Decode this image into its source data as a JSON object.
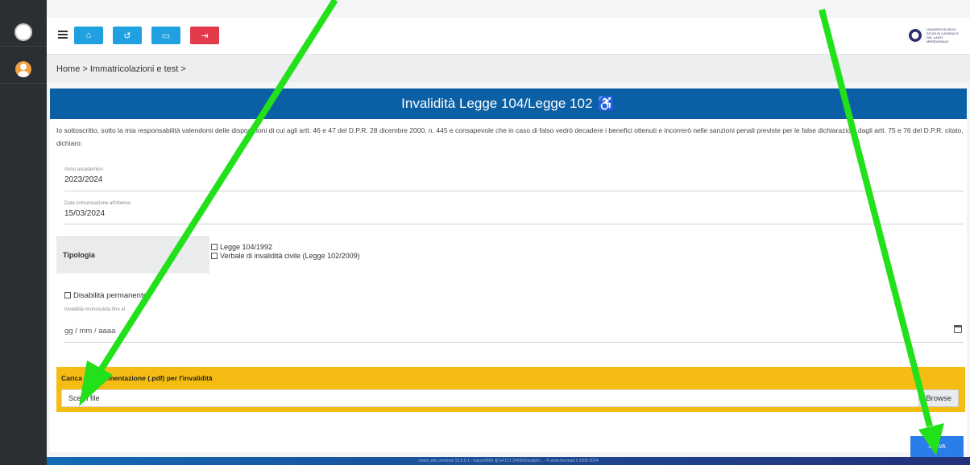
{
  "title_bar": {
    "title": "Invalidità Legge 104/Legge 102"
  },
  "breadcrumb": "Home > Immatricolazioni e test >",
  "intro": "Io sottoscritto, sotto la mia responsabilità valendomi delle disposizioni di cui agli artt. 46 e 47 del D.P.R. 28 dicembre 2000, n. 445 e consapevole che in caso di falso vedrò decadere i benefici ottenuti e incorrerò nelle sanzioni penali previste per le false dichiarazioni dagli artt. 75 e 76 del D.P.R. citato, dichiaro:",
  "fields": {
    "anno": {
      "label": "Anno accademico",
      "value": "2023/2024"
    },
    "data": {
      "label": "Data comunicazione all'Ateneo",
      "value": "15/03/2024"
    }
  },
  "tipologia": {
    "label": "Tipologia",
    "options": [
      "Legge 104/1992",
      "Verbale di invalidità civile (Legge 102/2009)"
    ]
  },
  "permanente": {
    "label": "Disabilità permanente"
  },
  "invalidita_fino": {
    "label": "Invalidità riconosciuta fino al",
    "placeholder": "gg / mm / aaaa"
  },
  "upload": {
    "label": "Carica la documentazione (.pdf) per l'invalidità",
    "placeholder": "Scegli file",
    "browse": "Browse"
  },
  "save_label": "SALVA",
  "footer": "smart_edu versione 12.0.0.1 - marco6669 @ EF171 24566/msakpfv...  - © www.besmart.it 2005-2024",
  "topbar_logo_text": "Università degli Studi di Cassino e del Lazio Meridionale",
  "colors": {
    "title_bar": "#0b5fa5",
    "upload_band": "#f5bd14",
    "annotation_arrow": "#22e01a"
  },
  "icons": [
    "home-icon",
    "history-icon",
    "card-icon",
    "logout-icon",
    "wheelchair-icon",
    "calendar-icon"
  ]
}
